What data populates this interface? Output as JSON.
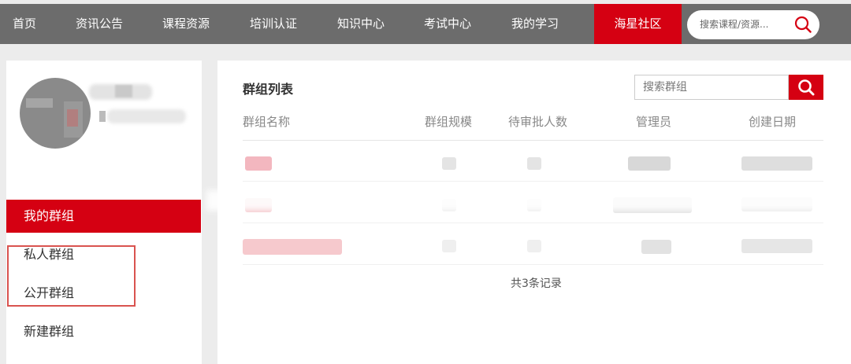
{
  "nav": {
    "items": [
      "首页",
      "资讯公告",
      "课程资源",
      "培训认证",
      "知识中心",
      "考试中心",
      "我的学习",
      "海星社区"
    ],
    "active_index": 7,
    "search_placeholder": "搜索课程/资源...",
    "search_icon": "search-icon"
  },
  "sidebar": {
    "items": [
      "我的群组",
      "私人群组",
      "公开群组",
      "新建群组"
    ],
    "active_index": 0
  },
  "main": {
    "title": "群组列表",
    "search_placeholder": "搜索群组",
    "columns": [
      "群组名称",
      "群组规模",
      "待审批人数",
      "管理员",
      "创建日期"
    ],
    "rows_count_text": "共3条记录"
  },
  "colors": {
    "accent": "#d50012",
    "nav_bg": "#6c6c6c",
    "page_bg": "#ececec"
  }
}
